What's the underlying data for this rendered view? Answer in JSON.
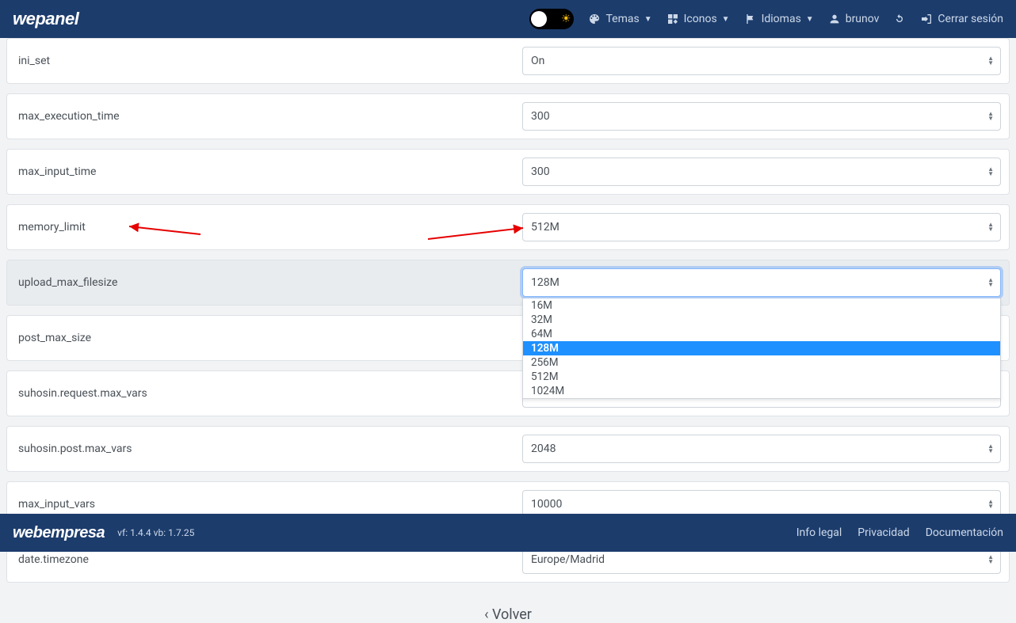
{
  "nav": {
    "logo": "wepanel",
    "temas": "Temas",
    "iconos": "Iconos",
    "idiomas": "Idiomas",
    "user": "brunov",
    "logout": "Cerrar sesión"
  },
  "settings": [
    {
      "key": "ini_set",
      "label": "ini_set",
      "value": "On",
      "highlighted": false
    },
    {
      "key": "max_execution_time",
      "label": "max_execution_time",
      "value": "300",
      "highlighted": false
    },
    {
      "key": "max_input_time",
      "label": "max_input_time",
      "value": "300",
      "highlighted": false
    },
    {
      "key": "memory_limit",
      "label": "memory_limit",
      "value": "512M",
      "highlighted": false
    },
    {
      "key": "upload_max_filesize",
      "label": "upload_max_filesize",
      "value": "128M",
      "highlighted": true,
      "focused": true,
      "open": true
    },
    {
      "key": "post_max_size",
      "label": "post_max_size",
      "value": "",
      "highlighted": false
    },
    {
      "key": "suhosin_request_max_vars",
      "label": "suhosin.request.max_vars",
      "value": "",
      "highlighted": false
    },
    {
      "key": "suhosin_post_max_vars",
      "label": "suhosin.post.max_vars",
      "value": "2048",
      "highlighted": false
    },
    {
      "key": "max_input_vars",
      "label": "max_input_vars",
      "value": "10000",
      "highlighted": false
    },
    {
      "key": "date_timezone",
      "label": "date.timezone",
      "value": "Europe/Madrid",
      "highlighted": false
    }
  ],
  "dropdown_options": [
    "16M",
    "32M",
    "64M",
    "128M",
    "256M",
    "512M",
    "1024M"
  ],
  "dropdown_selected": "128M",
  "back": "Volver",
  "footer": {
    "logo": "webempresa",
    "version": "vf: 1.4.4 vb: 1.7.25",
    "links": {
      "legal": "Info legal",
      "privacy": "Privacidad",
      "docs": "Documentación"
    }
  }
}
